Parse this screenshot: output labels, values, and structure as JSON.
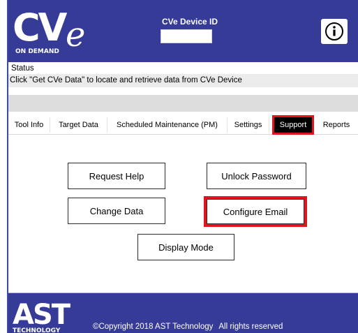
{
  "header": {
    "logo_letters": "CV",
    "logo_tail": "e",
    "logo_sub": "ON DEMAND",
    "device_id_label": "CVe Device ID",
    "device_id_value": "",
    "info_icon": "info-circle-icon"
  },
  "status": {
    "title": "Status",
    "message": "Click \"Get CVe Data\" to locate and retrieve data from CVe Device"
  },
  "tabs": [
    {
      "label": "Tool Info"
    },
    {
      "label": "Target Data"
    },
    {
      "label": "Scheduled Maintenance (PM)"
    },
    {
      "label": "Settings"
    },
    {
      "label": "Support",
      "active": true
    },
    {
      "label": "Reports"
    }
  ],
  "support": {
    "request_help": "Request Help",
    "unlock_password": "Unlock Password",
    "change_data": "Change Data",
    "configure_email": "Configure Email",
    "display_mode": "Display Mode"
  },
  "footer": {
    "logo_main": "AST",
    "logo_sub": "TECHNOLOGY",
    "copyright": "©Copyright 2018 AST Technology",
    "rights": "All rights reserved"
  },
  "colors": {
    "brand_blue": "#363b98",
    "highlight_red": "#e0161f"
  }
}
